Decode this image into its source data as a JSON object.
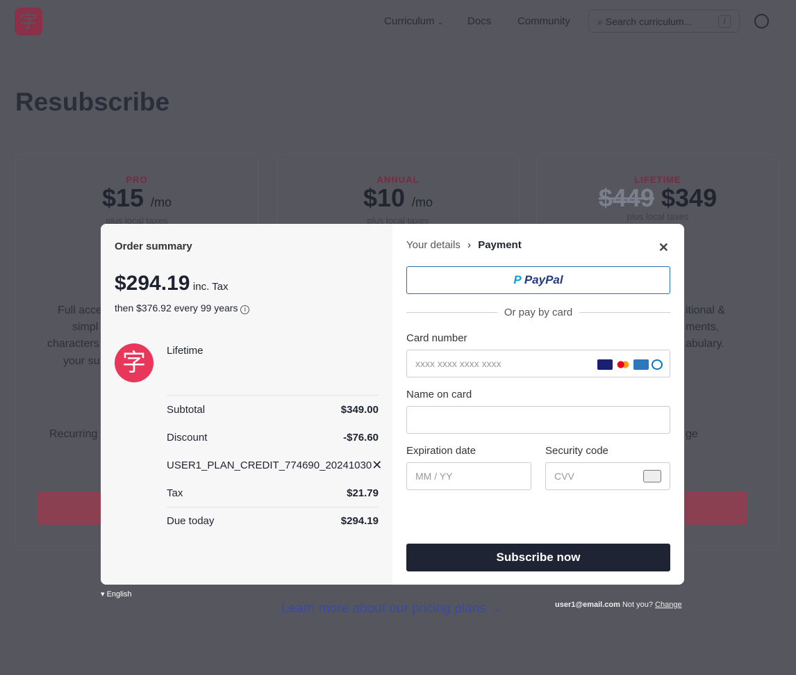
{
  "header": {
    "logo_glyph": "字",
    "nav": [
      "Curriculum",
      "Docs",
      "Community"
    ],
    "search_placeholder": "Search curriculum...",
    "search_shortcut": "/"
  },
  "page": {
    "title": "Resubscribe",
    "plans": [
      {
        "name": "PRO",
        "price": "$15",
        "unit": "/mo",
        "note": "plus local taxes"
      },
      {
        "name": "ANNUAL",
        "price": "$10",
        "unit": "/mo",
        "note": "plus local taxes"
      },
      {
        "name": "LIFETIME",
        "old_price": "$449",
        "price": "$349",
        "note": "plus local taxes"
      }
    ],
    "fragments_left": [
      "Full acce",
      "simpl",
      "characters",
      "your su",
      "Recurring"
    ],
    "fragments_right": [
      "itional &",
      "ments,",
      "abulary.",
      "ge"
    ]
  },
  "footer": {
    "language": "English",
    "learn_more": "Learn more about our pricing plans →",
    "email": "user1@email.com",
    "not_you": "Not you?",
    "change": "Change"
  },
  "modal": {
    "summary": {
      "title": "Order summary",
      "total": "$294.19",
      "inc_tax": "inc. Tax",
      "recurring": "then $376.92 every 99 years",
      "product": "Lifetime",
      "lines": [
        {
          "label": "Subtotal",
          "value": "$349.00"
        },
        {
          "label": "Discount",
          "value": "-$76.60"
        }
      ],
      "coupon": "USER1_PLAN_CREDIT_774690_20241030",
      "tax_label": "Tax",
      "tax": "$21.79",
      "due_label": "Due today",
      "due": "$294.19"
    },
    "payment": {
      "breadcrumb_prev": "Your details",
      "breadcrumb_current": "Payment",
      "paypal_label": "PayPal",
      "divider": "Or pay by card",
      "card_number_label": "Card number",
      "card_number_placeholder": "xxxx xxxx xxxx xxxx",
      "name_label": "Name on card",
      "name_value": "",
      "exp_label": "Expiration date",
      "exp_placeholder": "MM / YY",
      "cvv_label": "Security code",
      "cvv_placeholder": "CVV",
      "submit": "Subscribe now",
      "card_brands": [
        "visa",
        "mastercard",
        "amex",
        "diners"
      ]
    }
  },
  "colors": {
    "brand": "#e8375a",
    "submit": "#1e2433",
    "paypal_border": "#2c6cb0"
  }
}
